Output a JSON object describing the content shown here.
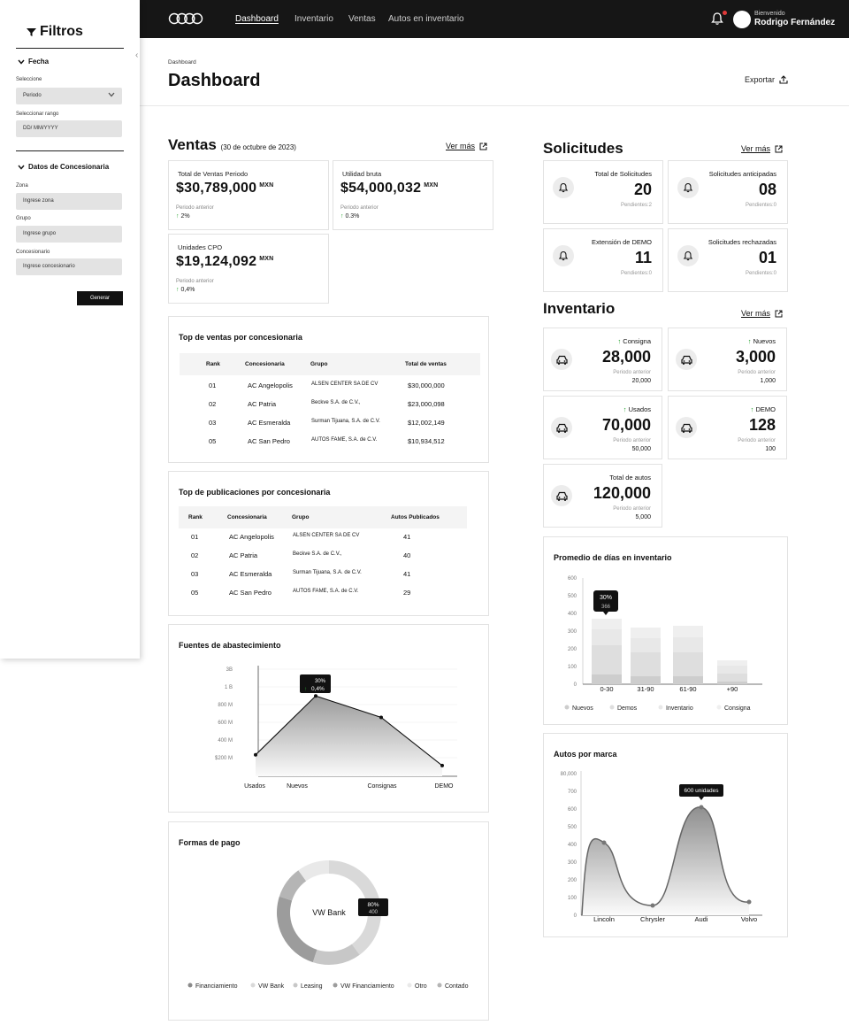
{
  "nav": {
    "items": [
      "Dashboard",
      "Inventario",
      "Ventas",
      "Autos en inventario"
    ],
    "welcome": "Bienvenido",
    "user": "Rodrigo Fernández"
  },
  "header": {
    "breadcrumb": "Dashboard",
    "title": "Dashboard",
    "export": "Exportar"
  },
  "sidebar": {
    "title": "Filtros",
    "fecha": {
      "title": "Fecha",
      "select_label": "Seleccione",
      "select_value": "Periodo",
      "range_label": "Seleccionar rango",
      "range_placeholder": "DD/ MM/YYYY"
    },
    "concesionaria": {
      "title": "Datos de Concesionaria",
      "zona_label": "Zona",
      "zona_placeholder": "Ingrese zona",
      "grupo_label": "Grupo",
      "grupo_placeholder": "Ingrese grupo",
      "conc_label": "Concesionario",
      "conc_placeholder": "Ingrese concesionario"
    },
    "generate": "Generar"
  },
  "ventas": {
    "title": "Ventas",
    "date": "(30 de octubre de 2023)",
    "vermas": "Ver más",
    "cards": [
      {
        "label": "Total de Ventas Periodo",
        "value": "$30,789,000",
        "unit": "MXN",
        "prev": "Periodo anterior",
        "pct": "2%"
      },
      {
        "label": "Utilidad bruta",
        "value": "$54,000,032",
        "unit": "MXN",
        "prev": "Periodo anterior",
        "pct": "0.3%"
      },
      {
        "label": "Unidades CPO",
        "value": "$19,124,092",
        "unit": "MXN",
        "prev": "Periodo anterior",
        "pct": "0,4%"
      }
    ]
  },
  "solicitudes": {
    "title": "Solicitudes",
    "vermas": "Ver más",
    "cards": [
      {
        "label": "Total de Solicitudes",
        "value": "20",
        "pending": "Pendientes:2"
      },
      {
        "label": "Solicitudes anticipadas",
        "value": "08",
        "pending": "Pendientes:0"
      },
      {
        "label": "Extensión de DEMO",
        "value": "11",
        "pending": "Pendientes:0"
      },
      {
        "label": "Solicitudes rechazadas",
        "value": "01",
        "pending": "Pendientes:0"
      }
    ]
  },
  "inventario": {
    "title": "Inventario",
    "vermas": "Ver más",
    "cards": [
      {
        "label": "Consigna",
        "value": "28,000",
        "prev": "Periodo anterior",
        "prev_value": "20,000",
        "arrow": true
      },
      {
        "label": "Nuevos",
        "value": "3,000",
        "prev": "Periodo anterior",
        "prev_value": "1,000",
        "arrow": true
      },
      {
        "label": "Usados",
        "value": "70,000",
        "prev": "Periodo anterior",
        "prev_value": "50,000",
        "arrow": true
      },
      {
        "label": "DEMO",
        "value": "128",
        "prev": "Periodo anterior",
        "prev_value": "100",
        "arrow": true
      },
      {
        "label": "Total de autos",
        "value": "120,000",
        "prev": "Periodo anterior",
        "prev_value": "5,000",
        "arrow": false
      }
    ]
  },
  "top_ventas": {
    "title": "Top de ventas por concesionaria",
    "headers": [
      "Rank",
      "Concesionaria",
      "Grupo",
      "Total de ventas"
    ],
    "rows": [
      [
        "01",
        "AC Angelopolis",
        "ALSEN CENTER SA DE CV",
        "$30,000,000"
      ],
      [
        "02",
        "AC Patria",
        "Beckve S.A. de C.V.,",
        "$23,000,098"
      ],
      [
        "03",
        "AC Esmeralda",
        "Surman Tijuana, S.A. de C.V.",
        "$12,002,149"
      ],
      [
        "05",
        "AC San Pedro",
        "AUTOS FAME, S.A. de C.V.",
        "$10,934,512"
      ]
    ]
  },
  "top_pub": {
    "title": "Top de publicaciones por concesionaria",
    "headers": [
      "Rank",
      "Concesionaria",
      "Grupo",
      "Autos Publicados"
    ],
    "rows": [
      [
        "01",
        "AC Angelopolis",
        "ALSEN CENTER SA DE CV",
        "41"
      ],
      [
        "02",
        "AC Patria",
        "Beckve S.A. de C.V.,",
        "40"
      ],
      [
        "03",
        "AC Esmeralda",
        "Surman Tijuana, S.A. de C.V.",
        "41"
      ],
      [
        "05",
        "AC San Pedro",
        "AUTOS FAME, S.A. de C.V.",
        "29"
      ]
    ]
  },
  "fuentes": {
    "title": "Fuentes de abastecimiento",
    "tooltip_pct": "30%",
    "tooltip_sub": "0,4%",
    "yticks": [
      "3B",
      "1 B",
      "800 M",
      "600 M",
      "400 M",
      "$200 M"
    ]
  },
  "formas": {
    "title": "Formas de pago",
    "center": "VW Bank",
    "tooltip_pct": "80%",
    "tooltip_val": "400",
    "legend": [
      "Financiamiento",
      "VW Bank",
      "Leasing",
      "VW Financiamiento",
      "Otro",
      "Contado"
    ]
  },
  "promedio": {
    "title": "Promedio de días en inventario",
    "tooltip_pct": "30%",
    "tooltip_val": "366",
    "legend": [
      "Nuevos",
      "Demos",
      "Inventario",
      "Consigna"
    ]
  },
  "marcas": {
    "title": "Autos por marca",
    "tooltip": "600 unidades"
  },
  "chart_data": [
    {
      "type": "area",
      "title": "Fuentes de abastecimiento",
      "categories": [
        "Usados",
        "Nuevos",
        "Consignas",
        "DEMO"
      ],
      "values": [
        300,
        850,
        650,
        200
      ],
      "ytick_labels": [
        "$200 M",
        "400 M",
        "600 M",
        "800 M",
        "1 B",
        "3B"
      ],
      "ylim": [
        100,
        1100
      ]
    },
    {
      "type": "pie",
      "title": "Formas de pago",
      "labels": [
        "Financiamiento",
        "VW Bank",
        "Leasing",
        "VW Financiamiento",
        "Otro",
        "Contado"
      ],
      "values": [
        0,
        40,
        15,
        25,
        10,
        10
      ],
      "colors": [
        "#8a8a8a",
        "#d9d9d9",
        "#c7c7c7",
        "#9c9c9c",
        "#e9e9e9",
        "#b5b5b5"
      ]
    },
    {
      "type": "bar",
      "title": "Promedio de días en inventario",
      "categories": [
        "0-30",
        "31-90",
        "61-90",
        "+90"
      ],
      "series": [
        {
          "name": "Nuevos",
          "values": [
            55,
            45,
            45,
            15
          ],
          "color": "#cdcdcd"
        },
        {
          "name": "Demos",
          "values": [
            165,
            135,
            135,
            45
          ],
          "color": "#dedede"
        },
        {
          "name": "Inventario",
          "values": [
            90,
            80,
            85,
            45
          ],
          "color": "#e8e8e8"
        },
        {
          "name": "Consigna",
          "values": [
            60,
            60,
            65,
            30
          ],
          "color": "#efefef"
        }
      ],
      "ylim": [
        0,
        600
      ],
      "yticks": [
        0,
        100,
        200,
        300,
        400,
        500,
        600
      ]
    },
    {
      "type": "area",
      "title": "Autos por marca",
      "categories": [
        "Lincoln",
        "Chrysler",
        "Audi",
        "Volvo"
      ],
      "values": [
        410,
        55,
        610,
        75
      ],
      "ylim": [
        0,
        800
      ],
      "ytick_labels": [
        "0",
        "100",
        "200",
        "300",
        "400",
        "500",
        "600",
        "700",
        "80,000"
      ]
    }
  ]
}
